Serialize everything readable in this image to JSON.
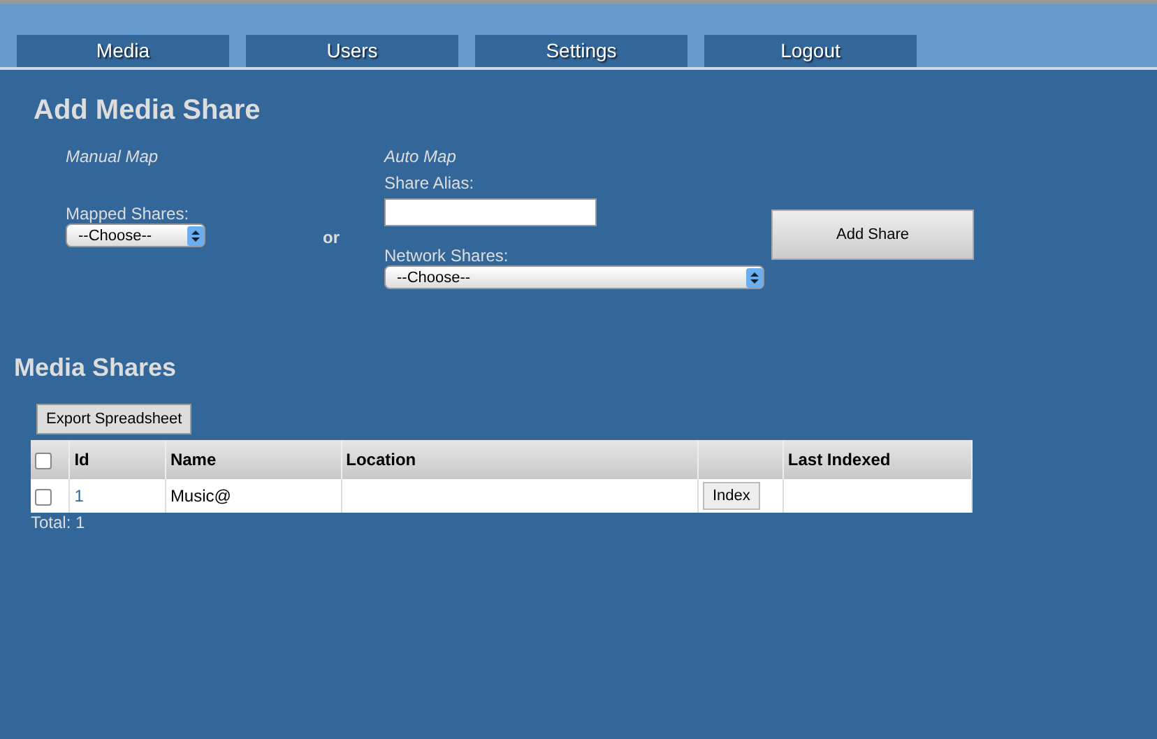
{
  "nav": [
    {
      "label": "Media"
    },
    {
      "label": "Users"
    },
    {
      "label": "Settings"
    },
    {
      "label": "Logout"
    }
  ],
  "add_share": {
    "title": "Add Media Share",
    "manual": {
      "heading": "Manual Map",
      "label": "Mapped Shares:",
      "select": "--Choose--"
    },
    "separator": "or",
    "auto": {
      "heading": "Auto Map",
      "alias_label": "Share Alias:",
      "network_label": "Network Shares:",
      "select": "--Choose--"
    },
    "button": "Add Share"
  },
  "media_shares": {
    "title": "Media Shares",
    "export_button": "Export Spreadsheet",
    "table": {
      "header_checked": false,
      "columns": [
        {
          "label": "Id"
        },
        {
          "label": "Name"
        },
        {
          "label": "Location"
        },
        {},
        {
          "label": "Last Indexed"
        }
      ],
      "rows": [
        {
          "checked": false,
          "cells": [
            {
              "kind": "link",
              "text": "1"
            },
            {
              "kind": "text",
              "text": "Music@"
            },
            {
              "kind": "text"
            },
            {
              "kind": "button",
              "text": "Index"
            },
            {
              "kind": "text"
            }
          ]
        }
      ]
    },
    "total": "Total: 1"
  }
}
